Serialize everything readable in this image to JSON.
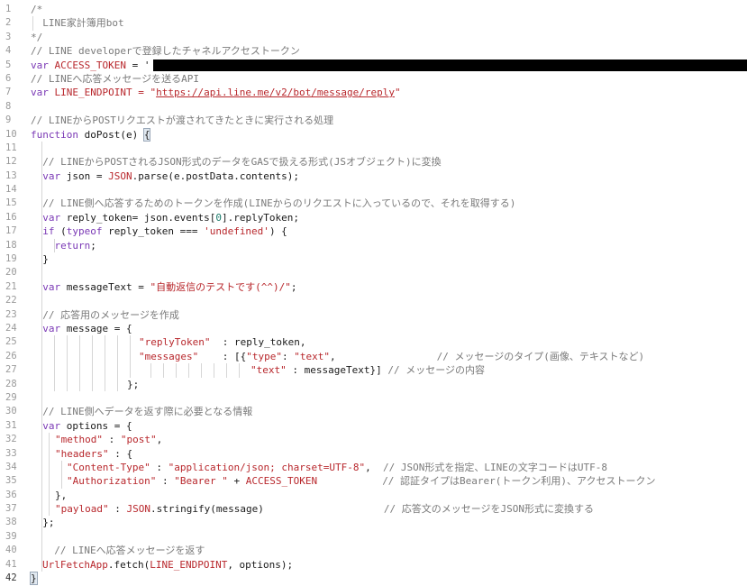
{
  "editor": {
    "line_numbers": [
      "1",
      "2",
      "3",
      "4",
      "5",
      "6",
      "7",
      "8",
      "9",
      "10",
      "11",
      "12",
      "13",
      "14",
      "15",
      "16",
      "17",
      "18",
      "19",
      "20",
      "21",
      "22",
      "23",
      "24",
      "25",
      "26",
      "27",
      "28",
      "29",
      "30",
      "31",
      "32",
      "33",
      "34",
      "35",
      "36",
      "37",
      "38",
      "39",
      "40",
      "41",
      "42"
    ],
    "active_line": "42",
    "redaction_color": "#000000"
  },
  "code": {
    "l1": "/*",
    "l2": "  LINE家計簿用bot",
    "l3": "*/",
    "l4": "// LINE developerで登録したチャネルアクセストークン",
    "l5_kw": "var ",
    "l5_var": "ACCESS_TOKEN",
    "l5_op": " = '",
    "l6": "// LINEへ応答メッセージを送るAPI",
    "l7_kw": "var ",
    "l7_var": "LINE_ENDPOINT",
    "l7_op": " = \"",
    "l7_url": "https://api.line.me/v2/bot/message/reply",
    "l7_end": "\"",
    "l9": "// LINEからPOSTリクエストが渡されてきたときに実行される処理",
    "l10_kw": "function ",
    "l10_fn": "doPost(e) ",
    "l10_brace": "{",
    "l12": "  // LINEからPOSTされるJSON形式のデータをGASで扱える形式(JSオブジェクト)に変換",
    "l13_kw": "  var ",
    "l13_a": "json = ",
    "l13_b": "JSON",
    "l13_c": ".parse(e.postData.contents);",
    "l15": "  // LINE側へ応答するためのトークンを作成(LINEからのリクエストに入っているので、それを取得する)",
    "l16_kw": "  var ",
    "l16_a": "reply_token= json.events[",
    "l16_num": "0",
    "l16_b": "].replyToken;",
    "l17_kw1": "  if ",
    "l17_a": "(",
    "l17_kw2": "typeof ",
    "l17_b": "reply_token === ",
    "l17_str": "'undefined'",
    "l17_c": ") {",
    "l18_kw": "    return",
    "l18_a": ";",
    "l19": "  }",
    "l21_kw": "  var ",
    "l21_a": "messageText = ",
    "l21_str": "\"自動返信のテストです(^^)/\"",
    "l21_b": ";",
    "l23": "  // 応答用のメッセージを作成",
    "l24_kw": "  var ",
    "l24_a": "message = {",
    "l25_key": "\"replyToken\"",
    "l25_a": "  : reply_token,",
    "l26_key": "\"messages\"",
    "l26_a": "    : [{",
    "l26_k2": "\"type\"",
    "l26_b": ": ",
    "l26_v2": "\"text\"",
    "l26_c": ",",
    "l26_com": "// メッセージのタイプ(画像、テキストなど)",
    "l27_key": "\"text\"",
    "l27_a": " : messageText}] ",
    "l27_com": "// メッセージの内容",
    "l28": "};",
    "l30": "  // LINE側へデータを返す際に必要となる情報",
    "l31_kw": "  var ",
    "l31_a": "options = {",
    "l32_key": "\"method\"",
    "l32_a": " : ",
    "l32_val": "\"post\"",
    "l32_b": ",",
    "l33_key": "\"headers\"",
    "l33_a": " : {",
    "l34_key": "\"Content-Type\"",
    "l34_a": " : ",
    "l34_val": "\"application/json; charset=UTF-8\"",
    "l34_b": ",  ",
    "l34_com": "// JSON形式を指定、LINEの文字コードはUTF-8",
    "l35_key": "\"Authorization\"",
    "l35_a": " : ",
    "l35_val": "\"Bearer \"",
    "l35_b": " + ",
    "l35_var": "ACCESS_TOKEN",
    "l35_com": "// 認証タイプはBearer(トークン利用)、アクセストークン",
    "l36": "},",
    "l37_key": "\"payload\"",
    "l37_a": " : ",
    "l37_var": "JSON",
    "l37_b": ".stringify(message)",
    "l37_com": "// 応答文のメッセージをJSON形式に変換する",
    "l38": "  };",
    "l40": "  // LINEへ応答メッセージを返す",
    "l41_var": "UrlFetchApp",
    "l41_a": ".fetch(",
    "l41_var2": "LINE_ENDPOINT",
    "l41_b": ", options);",
    "l42": "}"
  }
}
